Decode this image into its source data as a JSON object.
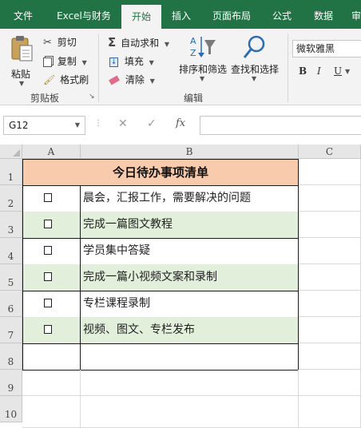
{
  "ribbon_tabs": [
    "文件",
    "Excel与财务",
    "开始",
    "插入",
    "页面布局",
    "公式",
    "数据",
    "审"
  ],
  "active_tab": "开始",
  "clipboard": {
    "paste_label": "粘贴",
    "cut_label": "剪切",
    "copy_label": "复制",
    "format_painter_label": "格式刷",
    "group_label": "剪贴板"
  },
  "editing": {
    "autosum_label": "自动求和",
    "fill_label": "填充",
    "clear_label": "清除",
    "sort_filter_label": "排序和筛选",
    "find_select_label": "查找和选择",
    "group_label": "编辑"
  },
  "font": {
    "font_name": "微软雅黑",
    "bold": "B",
    "italic": "I",
    "underline": "U"
  },
  "formula_bar": {
    "name_box": "G12",
    "fx": "fx",
    "formula": ""
  },
  "sheet": {
    "columns": [
      "A",
      "B",
      "C"
    ],
    "rows": [
      "1",
      "2",
      "3",
      "4",
      "5",
      "6",
      "7",
      "8",
      "9",
      "10"
    ],
    "title": "今日待办事项清单",
    "tasks": [
      {
        "text": "晨会，汇报工作，需要解决的问题",
        "highlight": false
      },
      {
        "text": "完成一篇图文教程",
        "highlight": true
      },
      {
        "text": "学员集中答疑",
        "highlight": false
      },
      {
        "text": "完成一篇小视频文案和录制",
        "highlight": true
      },
      {
        "text": "专栏课程录制",
        "highlight": false
      },
      {
        "text": "视频、图文、专栏发布",
        "highlight": true
      }
    ]
  },
  "colors": {
    "ribbon_green": "#217346",
    "title_fill": "#f8cbad",
    "row_highlight": "#e2efda"
  }
}
